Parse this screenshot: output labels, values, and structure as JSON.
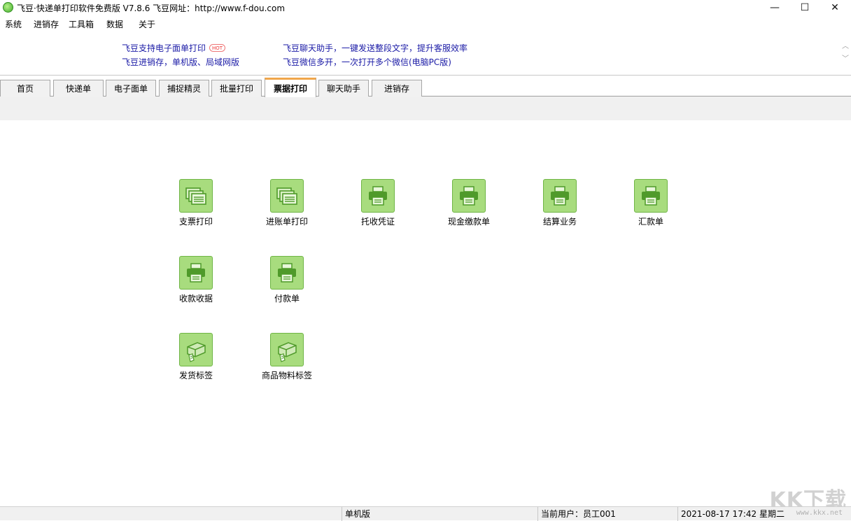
{
  "window": {
    "title": "飞豆·快递单打印软件免费版 V7.8.6  飞豆网址：http://www.f-dou.com",
    "minimize": "—",
    "maximize": "☐",
    "close": "✕"
  },
  "menu": [
    "系统",
    "进销存",
    "工具箱",
    "数据",
    "关于"
  ],
  "promos": {
    "p1": "飞豆支持电子面单打印",
    "p1_badge": "HOT",
    "p2": "飞豆进销存，单机版、局域网版",
    "p3": "飞豆聊天助手，一键发送整段文字，提升客服效率",
    "p4": "飞豆微信多开，一次打开多个微信(电脑PC版)"
  },
  "tabs": [
    "首页",
    "快递单",
    "电子面单",
    "捕捉精灵",
    "批量打印",
    "票据打印",
    "聊天助手",
    "进销存"
  ],
  "active_tab": "票据打印",
  "items": [
    {
      "label": "支票打印",
      "icon": "documents-icon"
    },
    {
      "label": "进账单打印",
      "icon": "documents-icon"
    },
    {
      "label": "托收凭证",
      "icon": "printer-icon"
    },
    {
      "label": "现金缴款单",
      "icon": "printer-icon"
    },
    {
      "label": "结算业务",
      "icon": "printer-icon"
    },
    {
      "label": "汇款单",
      "icon": "printer-icon"
    },
    {
      "label": "收款收据",
      "icon": "printer-icon"
    },
    {
      "label": "付款单",
      "icon": "printer-icon"
    },
    {
      "label": "发货标签",
      "icon": "label-printer-icon"
    },
    {
      "label": "商品物料标签",
      "icon": "label-printer-icon"
    }
  ],
  "status": {
    "mode": "单机版",
    "user": "当前用户：员工001",
    "datetime": "2021-08-17 17:42 星期二"
  },
  "watermark": {
    "main": "KK下载",
    "sub": "www.kkx.net"
  },
  "colors": {
    "tile": "#a8dc7e",
    "icon_dark": "#4f9a2a",
    "link": "#1a1aa6",
    "active_tab_accent": "#f0a64a"
  }
}
